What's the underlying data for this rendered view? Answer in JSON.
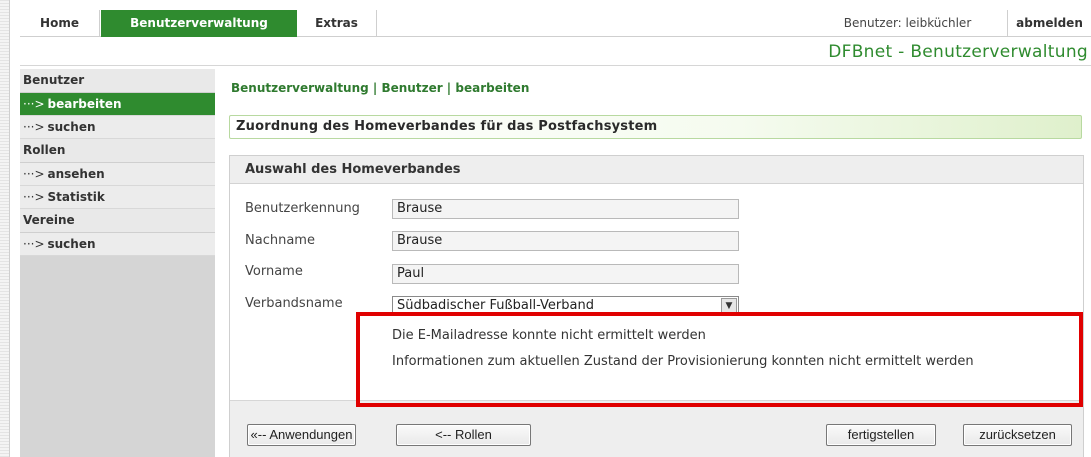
{
  "topnav": {
    "tabs": [
      {
        "label": "Home"
      },
      {
        "label": "Benutzerverwaltung"
      },
      {
        "label": "Extras"
      }
    ],
    "user_label": "Benutzer: leibküchler",
    "logout": "abmelden"
  },
  "app_title": "DFBnet - Benutzerverwaltung",
  "sidebar": {
    "groups": [
      {
        "heading": "Benutzer",
        "items": [
          {
            "label": "bearbeiten"
          },
          {
            "label": "suchen"
          }
        ]
      },
      {
        "heading": "Rollen",
        "items": [
          {
            "label": "ansehen"
          },
          {
            "label": "Statistik"
          }
        ]
      },
      {
        "heading": "Vereine",
        "items": [
          {
            "label": "suchen"
          }
        ]
      }
    ],
    "arrow": "···>"
  },
  "breadcrumb": "Benutzerverwaltung | Benutzer | bearbeiten",
  "section_title": "Zuordnung des Homeverbandes für das Postfachsystem",
  "panel": {
    "title": "Auswahl des Homeverbandes",
    "fields": {
      "benutzerkennung": {
        "label": "Benutzerkennung",
        "value": "Brause"
      },
      "nachname": {
        "label": "Nachname",
        "value": "Brause"
      },
      "vorname": {
        "label": "Vorname",
        "value": "Paul"
      },
      "verbandsname": {
        "label": "Verbandsname",
        "value": "Südbadischer Fußball-Verband"
      }
    },
    "messages": [
      "Die E-Mailadresse konnte nicht ermittelt werden",
      "Informationen zum aktuellen Zustand der Provisionierung konnten nicht ermittelt werden"
    ],
    "buttons": {
      "anwendungen": "«-- Anwendungen",
      "rollen": "<-- Rollen",
      "fertigstellen": "fertigstellen",
      "zuruecksetzen": "zurücksetzen"
    }
  },
  "colors": {
    "accent": "#2f8b2f",
    "highlight": "#e00000"
  }
}
